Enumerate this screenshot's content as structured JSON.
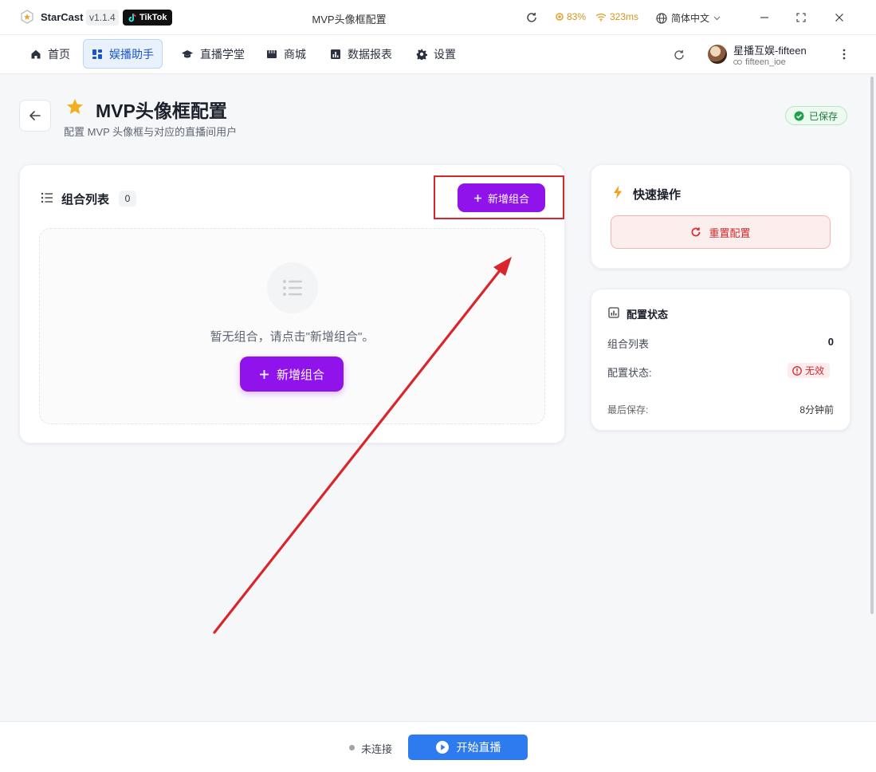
{
  "titlebar": {
    "app_name": "StarCast",
    "version": "v1.1.4",
    "tiktok_label": "TikTok",
    "window_title": "MVP头像框配置",
    "cpu": "83%",
    "latency": "323ms",
    "language": "简体中文"
  },
  "nav": {
    "items": [
      {
        "label": "首页",
        "icon": "home-icon"
      },
      {
        "label": "娱播助手",
        "icon": "dashboard-icon",
        "active": true
      },
      {
        "label": "直播学堂",
        "icon": "graduation-cap-icon"
      },
      {
        "label": "商城",
        "icon": "store-icon"
      },
      {
        "label": "数据报表",
        "icon": "chart-icon"
      },
      {
        "label": "设置",
        "icon": "gear-icon"
      }
    ],
    "user_name": "星播互娱-fifteen",
    "user_id": "fifteen_ioe"
  },
  "header": {
    "title": "MVP头像框配置",
    "subtitle": "配置 MVP 头像框与对应的直播间用户",
    "saved_label": "已保存"
  },
  "combo_list": {
    "title": "组合列表",
    "count": "0",
    "add_button_label": "新增组合",
    "empty_text": "暂无组合，请点击\"新增组合\"。",
    "empty_add_label": "新增组合"
  },
  "quick_actions": {
    "title": "快速操作",
    "reset_label": "重置配置"
  },
  "config_status": {
    "title": "配置状态",
    "rows": [
      {
        "label": "组合列表",
        "value": "0"
      },
      {
        "label": "配置状态:",
        "value": "无效"
      },
      {
        "label": "最后保存:",
        "value": "8分钟前"
      }
    ]
  },
  "bottom": {
    "connection": "未连接",
    "start_live_label": "开始直播"
  },
  "colors": {
    "accent_purple": "#8f13ea",
    "primary_blue": "#2e7bf0",
    "danger_red": "#d42a2a",
    "success_green": "#1e7a3c",
    "annotation_red": "#d8262c"
  }
}
